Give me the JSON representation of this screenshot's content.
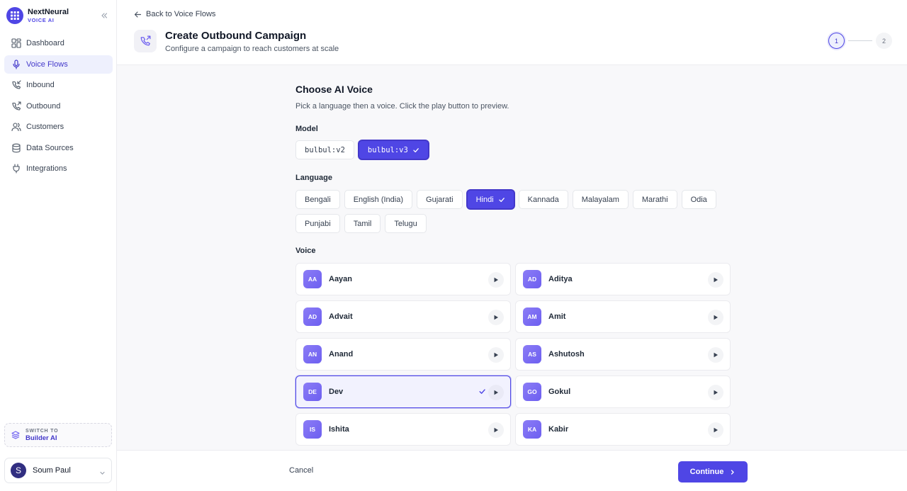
{
  "brand": {
    "name": "NextNeural",
    "sub": "VOICE AI"
  },
  "sidebar": {
    "items": [
      {
        "label": "Dashboard",
        "icon": "dashboard-icon"
      },
      {
        "label": "Voice Flows",
        "icon": "mic-icon",
        "active": true
      },
      {
        "label": "Inbound",
        "icon": "phone-incoming-icon"
      },
      {
        "label": "Outbound",
        "icon": "phone-outgoing-icon"
      },
      {
        "label": "Customers",
        "icon": "users-icon"
      },
      {
        "label": "Data Sources",
        "icon": "database-icon"
      },
      {
        "label": "Integrations",
        "icon": "plug-icon"
      }
    ],
    "switch": {
      "caption": "SWITCH TO",
      "target": "Builder AI"
    },
    "user": {
      "initial": "S",
      "name": "Soum Paul"
    }
  },
  "header": {
    "back": "Back to Voice Flows",
    "title": "Create Outbound Campaign",
    "subtitle": "Configure a campaign to reach customers at scale",
    "steps": [
      "1",
      "2"
    ],
    "current_step": 1
  },
  "main": {
    "title": "Choose AI Voice",
    "subtitle": "Pick a language then a voice. Click the play button to preview.",
    "model_label": "Model",
    "models": [
      {
        "label": "bulbul:v2",
        "selected": false
      },
      {
        "label": "bulbul:v3",
        "selected": true
      }
    ],
    "language_label": "Language",
    "languages": [
      {
        "label": "Bengali",
        "selected": false
      },
      {
        "label": "English (India)",
        "selected": false
      },
      {
        "label": "Gujarati",
        "selected": false
      },
      {
        "label": "Hindi",
        "selected": true
      },
      {
        "label": "Kannada",
        "selected": false
      },
      {
        "label": "Malayalam",
        "selected": false
      },
      {
        "label": "Marathi",
        "selected": false
      },
      {
        "label": "Odia",
        "selected": false
      },
      {
        "label": "Punjabi",
        "selected": false
      },
      {
        "label": "Tamil",
        "selected": false
      },
      {
        "label": "Telugu",
        "selected": false
      }
    ],
    "voice_label": "Voice",
    "voices": [
      {
        "initials": "AA",
        "name": "Aayan",
        "selected": false
      },
      {
        "initials": "AD",
        "name": "Aditya",
        "selected": false
      },
      {
        "initials": "AD",
        "name": "Advait",
        "selected": false
      },
      {
        "initials": "AM",
        "name": "Amit",
        "selected": false
      },
      {
        "initials": "AN",
        "name": "Anand",
        "selected": false
      },
      {
        "initials": "AS",
        "name": "Ashutosh",
        "selected": false
      },
      {
        "initials": "DE",
        "name": "Dev",
        "selected": true
      },
      {
        "initials": "GO",
        "name": "Gokul",
        "selected": false
      },
      {
        "initials": "IS",
        "name": "Ishita",
        "selected": false
      },
      {
        "initials": "KA",
        "name": "Kabir",
        "selected": false
      }
    ]
  },
  "footer": {
    "cancel": "Cancel",
    "continue": "Continue"
  },
  "colors": {
    "accent": "#4f46e5",
    "accent_light": "#eef0fd"
  }
}
